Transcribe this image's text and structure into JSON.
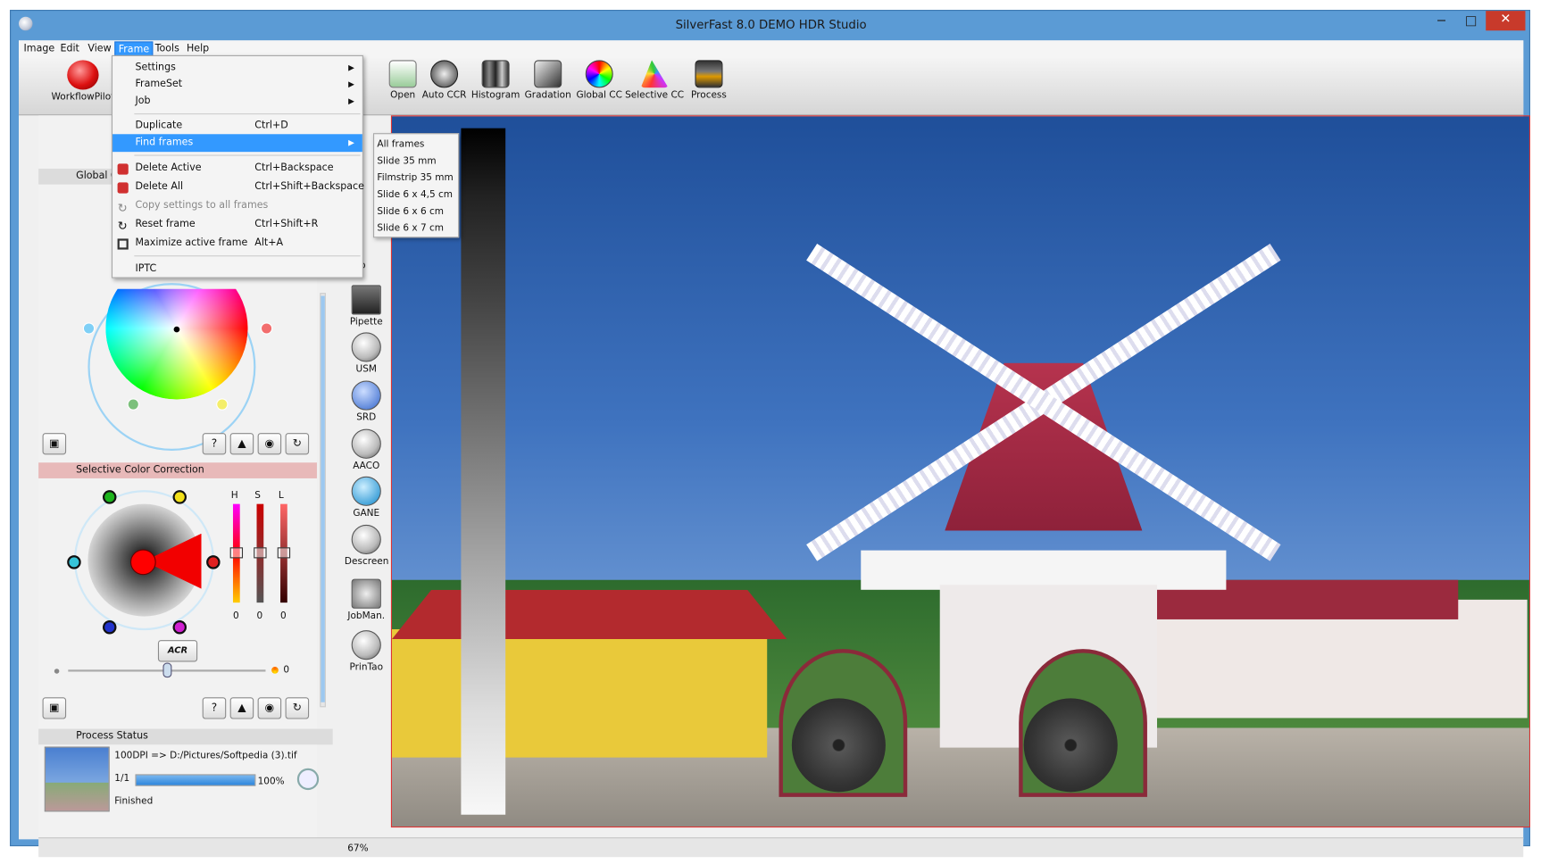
{
  "window": {
    "title": "SilverFast 8.0 DEMO  HDR Studio",
    "min": "−",
    "max": "□",
    "close": "✕"
  },
  "menubar": [
    "Image",
    "Edit",
    "View",
    "Frame",
    "Tools",
    "Help"
  ],
  "toolbar": {
    "workflowpilot": "WorkflowPilot",
    "buttons": [
      "Open",
      "Auto CCR",
      "Histogram",
      "Gradation",
      "Global CC",
      "Selective CC",
      "Process"
    ]
  },
  "frame_menu": {
    "items": [
      {
        "label": "Settings",
        "shortcut": "",
        "submenu": true
      },
      {
        "label": "FrameSet",
        "shortcut": "",
        "submenu": true
      },
      {
        "label": "Job",
        "shortcut": "",
        "submenu": true
      },
      {
        "label": "Duplicate",
        "shortcut": "Ctrl+D",
        "submenu": false
      },
      {
        "label": "Find frames",
        "shortcut": "",
        "submenu": true
      },
      {
        "label": "Delete Active",
        "shortcut": "Ctrl+Backspace",
        "submenu": false
      },
      {
        "label": "Delete All",
        "shortcut": "Ctrl+Shift+Backspace",
        "submenu": false
      },
      {
        "label": "Copy settings to all frames",
        "shortcut": "",
        "submenu": false
      },
      {
        "label": "Reset frame",
        "shortcut": "Ctrl+Shift+R",
        "submenu": false
      },
      {
        "label": "Maximize active frame",
        "shortcut": "Alt+A",
        "submenu": false
      },
      {
        "label": "IPTC",
        "shortcut": "",
        "submenu": false
      }
    ]
  },
  "find_frames_submenu": [
    "All frames",
    "Slide 35 mm",
    "Filmstrip 35 mm",
    "Slide 6 x 4,5 cm",
    "Slide 6 x 6 cm",
    "Slide 6 x 7 cm"
  ],
  "left_panel": {
    "global_cc_header": "Global C",
    "selective_cc_header": "Selective Color Correction",
    "hsl": {
      "labels": [
        "H",
        "S",
        "L"
      ],
      "values": [
        "0",
        "0",
        "0"
      ]
    },
    "acr_label": "ACR",
    "slider_value": "0",
    "process_status_header": "Process Status",
    "process": {
      "line": "100DPI => D:/Pictures/Softpedia (3).tif",
      "count": "1/1",
      "percent": "100%",
      "state": "Finished",
      "progress": 1.0
    }
  },
  "vertical_tools": {
    "partial": "lip",
    "items": [
      "Pipette",
      "USM",
      "SRD",
      "AACO",
      "GANE",
      "Descreen",
      "JobMan.",
      "PrinTao"
    ]
  },
  "statusbar": {
    "zoom": "67%"
  },
  "colors": {
    "selected": "#3399ff",
    "titlebar": "#5b9bd5",
    "accent": "#cc2222"
  }
}
